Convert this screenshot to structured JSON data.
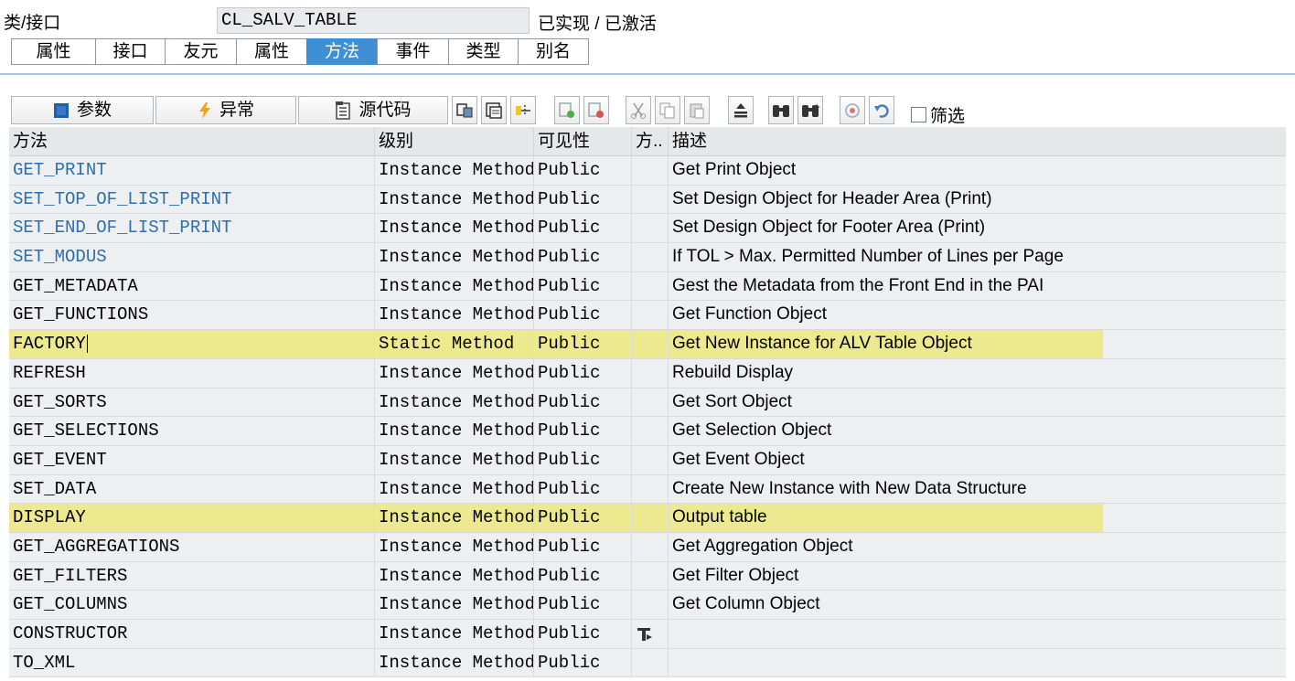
{
  "header": {
    "class_label": "类/接口",
    "class_name": "CL_SALV_TABLE",
    "status": "已实现 / 已激活"
  },
  "tabs": [
    {
      "label": "属性",
      "active": false
    },
    {
      "label": "接口",
      "active": false
    },
    {
      "label": "友元",
      "active": false
    },
    {
      "label": "属性",
      "active": false
    },
    {
      "label": "方法",
      "active": true
    },
    {
      "label": "事件",
      "active": false
    },
    {
      "label": "类型",
      "active": false
    },
    {
      "label": "别名",
      "active": false
    }
  ],
  "toolbar": {
    "params_label": "参数",
    "exceptions_label": "异常",
    "source_label": "源代码",
    "filter_label": "筛选",
    "icons": [
      "navigate-icon",
      "display-object-icon",
      "hierarchy-icon",
      "insert-row-icon",
      "delete-row-icon",
      "cut-icon",
      "copy-icon",
      "paste-icon",
      "sort-icon",
      "find-icon",
      "find-next-icon",
      "detail-view-icon",
      "undo-icon"
    ]
  },
  "colors": {
    "accent": "#3e8fd4",
    "link": "#2d6fae",
    "highlight": "#ece98f",
    "row_bg": "#edeff0"
  },
  "table": {
    "columns": [
      "方法",
      "级别",
      "可见性",
      "方..",
      "描述"
    ],
    "rows": [
      {
        "name": "GET_PRINT",
        "level": "Instance Method",
        "visibility": "Public",
        "mark": "",
        "desc": "Get Print Object",
        "link": true,
        "hl": false
      },
      {
        "name": "SET_TOP_OF_LIST_PRINT",
        "level": "Instance Method",
        "visibility": "Public",
        "mark": "",
        "desc": "Set Design Object for Header Area (Print)",
        "link": true,
        "hl": false
      },
      {
        "name": "SET_END_OF_LIST_PRINT",
        "level": "Instance Method",
        "visibility": "Public",
        "mark": "",
        "desc": "Set Design Object for Footer Area (Print)",
        "link": true,
        "hl": false
      },
      {
        "name": "SET_MODUS",
        "level": "Instance Method",
        "visibility": "Public",
        "mark": "",
        "desc": "If TOL > Max. Permitted Number of Lines per Page",
        "link": true,
        "hl": false
      },
      {
        "name": "GET_METADATA",
        "level": "Instance Method",
        "visibility": "Public",
        "mark": "",
        "desc": "Gest the Metadata from the Front End in the PAI",
        "link": false,
        "hl": false
      },
      {
        "name": "GET_FUNCTIONS",
        "level": "Instance Method",
        "visibility": "Public",
        "mark": "",
        "desc": "Get Function Object",
        "link": false,
        "hl": false
      },
      {
        "name": "FACTORY",
        "level": "Static Method",
        "visibility": "Public",
        "mark": "",
        "desc": "Get New Instance for ALV Table Object",
        "link": false,
        "hl": true,
        "cursor": true
      },
      {
        "name": "REFRESH",
        "level": "Instance Method",
        "visibility": "Public",
        "mark": "",
        "desc": "Rebuild Display",
        "link": false,
        "hl": false
      },
      {
        "name": "GET_SORTS",
        "level": "Instance Method",
        "visibility": "Public",
        "mark": "",
        "desc": "Get Sort Object",
        "link": false,
        "hl": false
      },
      {
        "name": "GET_SELECTIONS",
        "level": "Instance Method",
        "visibility": "Public",
        "mark": "",
        "desc": "Get Selection Object",
        "link": false,
        "hl": false
      },
      {
        "name": "GET_EVENT",
        "level": "Instance Method",
        "visibility": "Public",
        "mark": "",
        "desc": "Get Event Object",
        "link": false,
        "hl": false
      },
      {
        "name": "SET_DATA",
        "level": "Instance Method",
        "visibility": "Public",
        "mark": "",
        "desc": "Create New Instance with New Data Structure",
        "link": false,
        "hl": false
      },
      {
        "name": "DISPLAY",
        "level": "Instance Method",
        "visibility": "Public",
        "mark": "",
        "desc": "Output table",
        "link": false,
        "hl": true
      },
      {
        "name": "GET_AGGREGATIONS",
        "level": "Instance Method",
        "visibility": "Public",
        "mark": "",
        "desc": "Get Aggregation Object",
        "link": false,
        "hl": false
      },
      {
        "name": "GET_FILTERS",
        "level": "Instance Method",
        "visibility": "Public",
        "mark": "",
        "desc": "Get Filter Object",
        "link": false,
        "hl": false
      },
      {
        "name": "GET_COLUMNS",
        "level": "Instance Method",
        "visibility": "Public",
        "mark": "",
        "desc": "Get Column Object",
        "link": false,
        "hl": false
      },
      {
        "name": "CONSTRUCTOR",
        "level": "Instance Method",
        "visibility": "Public",
        "mark": "constructor-icon",
        "desc": "",
        "link": false,
        "hl": false
      },
      {
        "name": "TO_XML",
        "level": "Instance Method",
        "visibility": "Public",
        "mark": "",
        "desc": "",
        "link": false,
        "hl": false
      }
    ]
  }
}
